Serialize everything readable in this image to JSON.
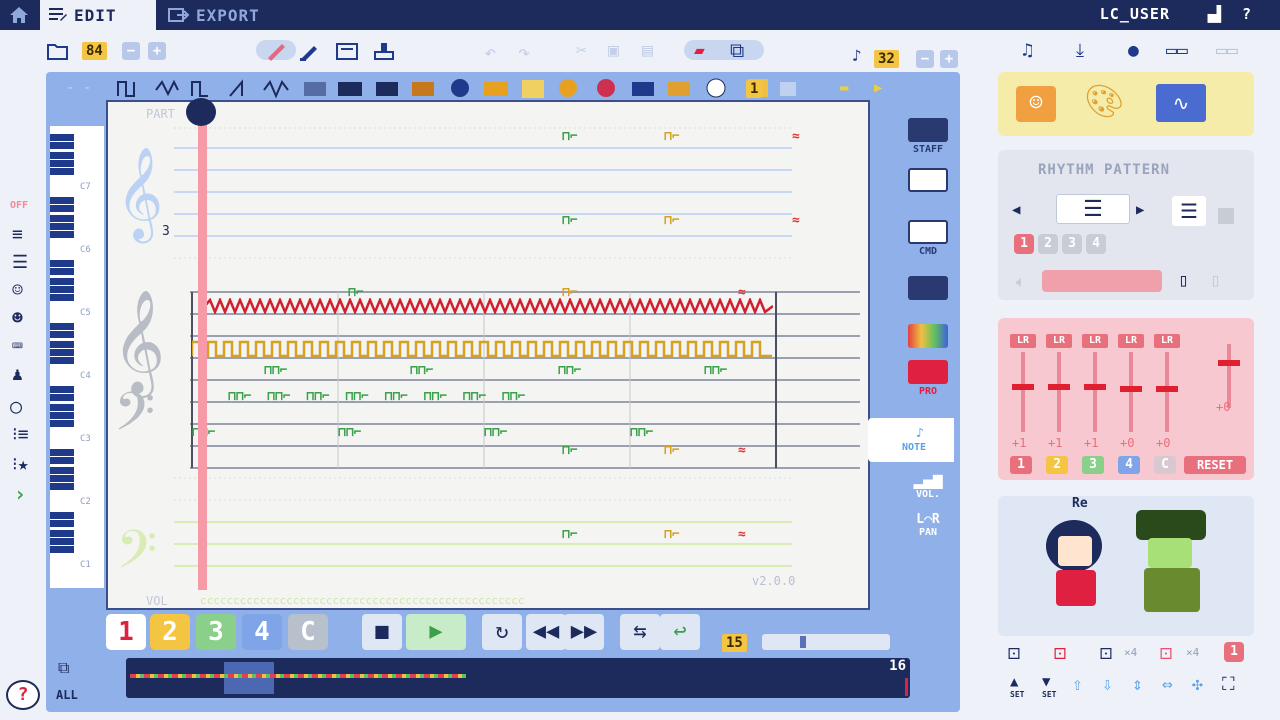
{
  "header": {
    "tabs": [
      {
        "label": "EDIT"
      },
      {
        "label": "EXPORT"
      }
    ],
    "user": "LC_USER",
    "help": "?"
  },
  "toolbar": {
    "file_number": "84",
    "tempo": "32",
    "instrument_number": "1"
  },
  "score": {
    "part_label": "PART",
    "triplet_mark": "3",
    "octave_labels": [
      "C7",
      "C6",
      "C5",
      "C4",
      "C3",
      "C2",
      "C1"
    ],
    "vol_label": "VOL",
    "version": "v2.0.0"
  },
  "right_tabs": {
    "staff": "STAFF",
    "cmd": "CMD",
    "pro": "PRO",
    "note": "NOTE",
    "vol": "VOL.",
    "pan": "PAN"
  },
  "left_tools": {
    "off": "OFF"
  },
  "channels": [
    "1",
    "2",
    "3",
    "4",
    "C"
  ],
  "transport": {
    "loop_count": "15"
  },
  "minimap": {
    "page_total": "16",
    "select_all": "ALL"
  },
  "rhythm_panel": {
    "title": "RHYTHM PATTERN",
    "slots": [
      "1",
      "2",
      "3",
      "4"
    ]
  },
  "mixer": {
    "channel_label": "LR",
    "values": [
      "+1",
      "+1",
      "+1",
      "+0",
      "+0"
    ],
    "master_value": "+0",
    "channel_buttons": [
      "1",
      "2",
      "3",
      "4",
      "C"
    ],
    "reset": "RESET"
  },
  "chars_panel": {
    "speech": "Re"
  },
  "bottom_right": {
    "set1": "SET",
    "set2": "SET",
    "x4a": "×4",
    "x4b": "×4"
  },
  "colors": {
    "navy": "#1c2a5c",
    "green_channel": "#3aa04a",
    "yellow_channel": "#d6a020",
    "red_channel": "#d33333",
    "playhead": "#f59aa6"
  }
}
